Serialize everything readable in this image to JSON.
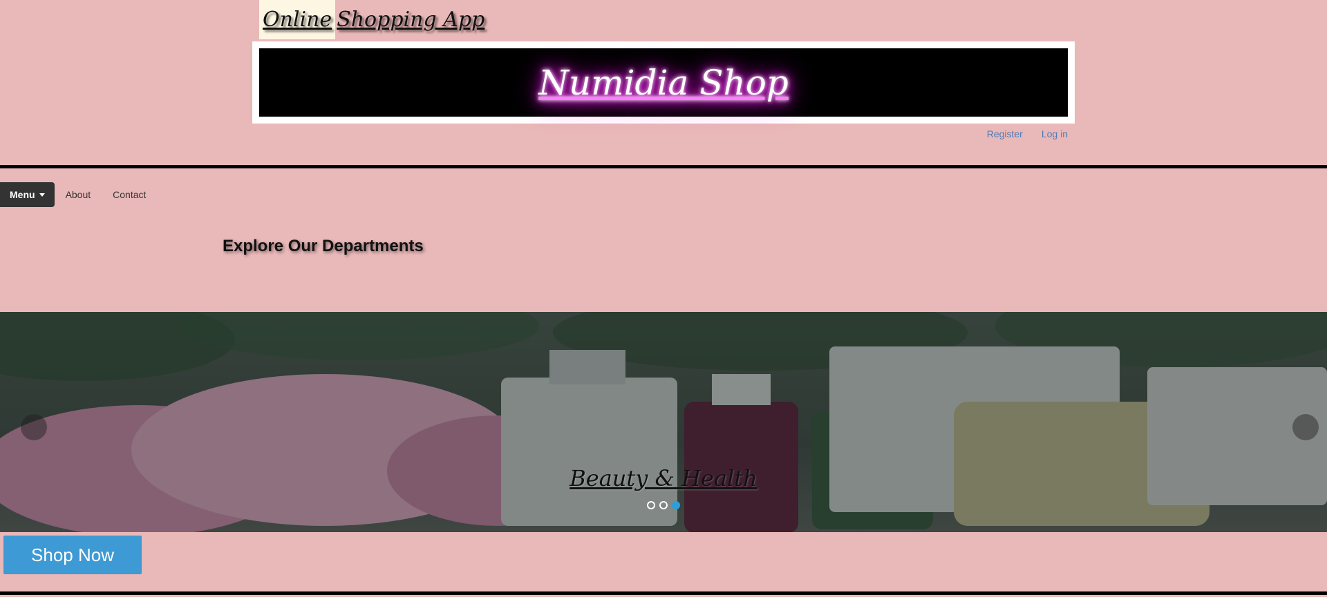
{
  "header": {
    "app_title_first": "Online",
    "app_title_rest": "Shopping App",
    "banner_text": "Numidia Shop"
  },
  "auth": {
    "register_label": "Register",
    "login_label": "Log in"
  },
  "nav": {
    "menu_label": "Menu",
    "about_label": "About",
    "contact_label": "Contact"
  },
  "departments": {
    "heading": "Explore Our Departments"
  },
  "carousel": {
    "caption": "Beauty & Health",
    "slides_count": 3,
    "active_slide": 3
  },
  "cta": {
    "shop_now_label": "Shop Now"
  },
  "colors": {
    "background": "#e9b8b8",
    "neon_glow": "#ff3bff",
    "link": "#4a7bb7",
    "cta": "#3e9ad4",
    "indicator_active": "#2b9fd8"
  }
}
